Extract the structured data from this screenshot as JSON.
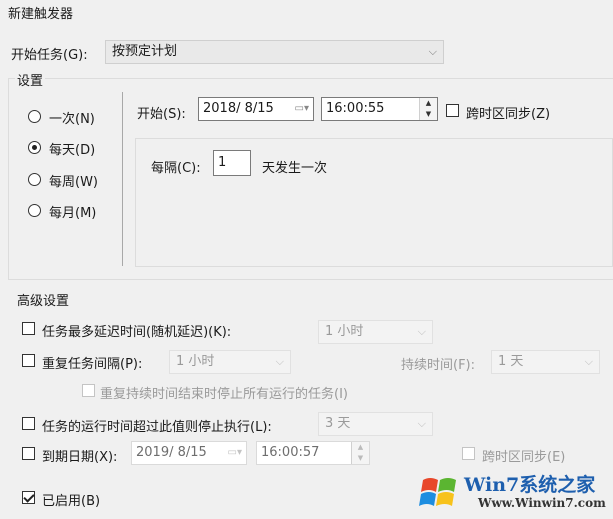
{
  "window": {
    "title": "新建触发器"
  },
  "begin_task": {
    "label": "开始任务(G):",
    "value": "按预定计划"
  },
  "settings": {
    "legend": "设置",
    "schedule_options": [
      {
        "label": "一次(N)",
        "checked": false
      },
      {
        "label": "每天(D)",
        "checked": true
      },
      {
        "label": "每周(W)",
        "checked": false
      },
      {
        "label": "每月(M)",
        "checked": false
      }
    ],
    "start_label": "开始(S):",
    "start_date": "2018/ 8/15",
    "start_time": "16:00:55",
    "sync_timezone_label": "跨时区同步(Z)",
    "recur_label": "每隔(C):",
    "recur_value": "1",
    "recur_suffix": "天发生一次"
  },
  "advanced": {
    "legend": "高级设置",
    "delay": {
      "label": "任务最多延迟时间(随机延迟)(K):",
      "value": "1 小时"
    },
    "repeat": {
      "label": "重复任务间隔(P):",
      "value": "1 小时",
      "duration_label": "持续时间(F):",
      "duration_value": "1 天",
      "stop_label": "重复持续时间结束时停止所有运行的任务(I)"
    },
    "stop_if": {
      "label": "任务的运行时间超过此值则停止执行(L):",
      "value": "3 天"
    },
    "expire": {
      "label": "到期日期(X):",
      "date": "2019/ 8/15",
      "time": "16:00:57",
      "sync_label": "跨时区同步(E)"
    },
    "enabled": {
      "label": "已启用(B)",
      "checked": true
    }
  },
  "watermark": {
    "text": "Win7系统之家",
    "url": "Www.Winwin7.com"
  },
  "colors": {
    "background": "#f0f0f0",
    "disabled_text": "#9a9a9a",
    "border": "#7a7a7a"
  }
}
